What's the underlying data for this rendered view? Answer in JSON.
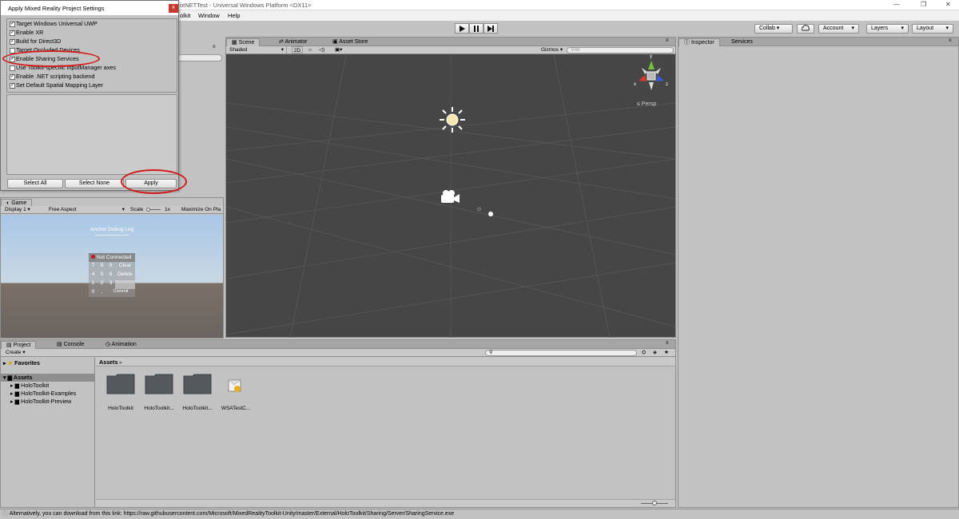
{
  "window": {
    "title": "otNETTest - Universal Windows Platform <DX11>",
    "minimize": "—",
    "restore": "❐",
    "close": "✕"
  },
  "menu": {
    "items": [
      "olkit",
      "Window",
      "Help"
    ]
  },
  "toolbar": {
    "collab": "Collab ▾",
    "account": "Account",
    "layers": "Layers",
    "layout": "Layout",
    "cloud_icon": "cloud-icon",
    "play_icon": "play-icon",
    "pause_icon": "pause-icon",
    "step_icon": "step-icon"
  },
  "dialog": {
    "title": "Apply Mixed Reality Project Settings",
    "close": "x",
    "options": [
      {
        "label": "Target Windows Universal UWP",
        "checked": true
      },
      {
        "label": "Enable XR",
        "checked": true
      },
      {
        "label": "Build for Direct3D",
        "checked": true
      },
      {
        "label": "Target Occluded Devices",
        "checked": false
      },
      {
        "label": "Enable Sharing Services",
        "checked": true
      },
      {
        "label": "Use Toolkit-specific InputManager axes",
        "checked": false
      },
      {
        "label": "Enable .NET scripting backend",
        "checked": true
      },
      {
        "label": "Set Default Spatial Mapping Layer",
        "checked": true
      }
    ],
    "select_all": "Select All",
    "select_none": "Select None",
    "apply": "Apply"
  },
  "scene": {
    "tabs": [
      "Scene",
      "Animator",
      "Asset Store"
    ],
    "shading": "Shaded",
    "mode_2d": "2D",
    "gizmos": "Gizmos",
    "search_placeholder": "All",
    "persp": "Persp",
    "axis_y": "y",
    "axis_x": "x",
    "axis_z": "z"
  },
  "inspector": {
    "tabs": [
      "Inspector",
      "Services"
    ]
  },
  "game": {
    "tab": "Game",
    "display": "Display 1",
    "aspect": "Free Aspect",
    "scale_label": "Scale",
    "scale_value": "1x",
    "maximize": "Maximize On Pla",
    "debug_title": "Anchor Debug Log",
    "status": "Not Connected",
    "keys": [
      [
        "7",
        "8",
        "9",
        "Clear"
      ],
      [
        "4",
        "5",
        "6",
        "Delete"
      ],
      [
        "1",
        "2",
        "3",
        ""
      ],
      [
        "0",
        ".",
        "Commit",
        ""
      ]
    ]
  },
  "project": {
    "tabs": [
      "Project",
      "Console",
      "Animation"
    ],
    "create": "Create",
    "favorites": "Favorites",
    "assets_root": "Assets",
    "tree": [
      "HoloToolkit",
      "HoloToolkit-Examples",
      "HoloToolkit-Preview"
    ],
    "breadcrumb": "Assets",
    "items": [
      "HoloToolkit",
      "HoloToolkit...",
      "HoloToolkit...",
      "WSATestC..."
    ]
  },
  "status": {
    "text": "Alternatively, you can download from this link: https://raw.githubusercontent.com/Microsoft/MixedRealityToolkit-Unity/master/External/HoloToolkit/Sharing/Server/SharingService.exe"
  }
}
